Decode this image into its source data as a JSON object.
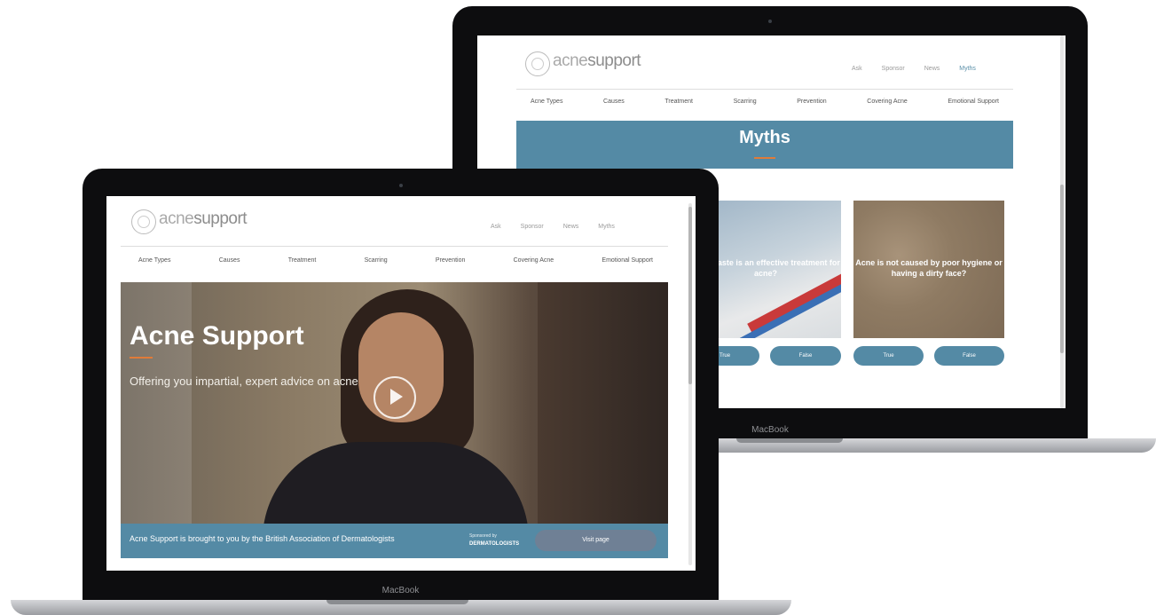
{
  "back_site": {
    "logo": {
      "part1": "acne",
      "part2": "support"
    },
    "top_links": [
      "Ask",
      "Sponsor",
      "News",
      "Myths"
    ],
    "nav": [
      "Acne Types",
      "Causes",
      "Treatment",
      "Scarring",
      "Prevention",
      "Covering Acne",
      "Emotional Support"
    ],
    "banner_title": "Myths",
    "cards": [
      {
        "text": "Toothpaste is an effective treatment for acne?",
        "buttons": [
          "True",
          "False"
        ]
      },
      {
        "text": "Acne is not caused by poor hygiene or having a dirty face?",
        "buttons": [
          "True",
          "False"
        ]
      }
    ],
    "chin_label": "MacBook"
  },
  "front_site": {
    "logo": {
      "part1": "acne",
      "part2": "support"
    },
    "top_links": [
      "Ask",
      "Sponsor",
      "News",
      "Myths"
    ],
    "nav": [
      "Acne Types",
      "Causes",
      "Treatment",
      "Scarring",
      "Prevention",
      "Covering Acne",
      "Emotional Support"
    ],
    "hero": {
      "title": "Acne Support",
      "subtitle": "Offering you impartial, expert advice on acne"
    },
    "sponsor": {
      "text": "Acne Support is brought to you by the British Association of Dermatologists",
      "by_label": "Sponsored by",
      "by_name": "DERMATOLOGISTS",
      "button": "Visit page"
    },
    "chin_label": "MacBook"
  },
  "colors": {
    "brand_blue": "#548aa5",
    "accent_orange": "#e07b39",
    "visit_button": "#6f8095"
  }
}
